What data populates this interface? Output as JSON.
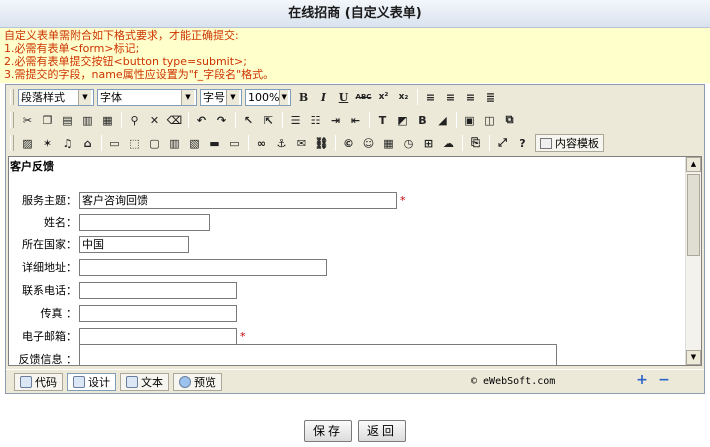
{
  "title": "在线招商 (自定义表单)",
  "notice": {
    "lines": [
      "自定义表单需附合如下格式要求，才能正确提交:",
      "1.必需有表单<form>标记;",
      "2.必需有表单提交按钮<button type=submit>;",
      "3.需提交的字段，name属性应设置为\"f_字段名\"格式。"
    ]
  },
  "toolbar": {
    "paragraph_style": "段落样式",
    "font_family": "字体",
    "font_size": "字号",
    "zoom": "100%",
    "template_button": "内容模板"
  },
  "form": {
    "heading": "客户反馈",
    "required_mark": "*",
    "fields": [
      {
        "label": "服务主题：",
        "value": "客户咨询回馈"
      },
      {
        "label": "姓名：",
        "value": ""
      },
      {
        "label": "所在国家：",
        "value": "中国"
      },
      {
        "label": "详细地址：",
        "value": ""
      },
      {
        "label": "联系电话：",
        "value": ""
      },
      {
        "label": "传真 ：",
        "value": ""
      },
      {
        "label": "电子邮箱：",
        "value": ""
      },
      {
        "label": "反馈信息 ：",
        "value": ""
      }
    ]
  },
  "modes": {
    "code": "代码",
    "design": "设计",
    "text": "文本",
    "preview": "预览"
  },
  "brand": "© eWebSoft.com",
  "zoom_controls": {
    "plus": "+",
    "minus": "−"
  },
  "actions": {
    "save": "保存",
    "back": "返回"
  }
}
